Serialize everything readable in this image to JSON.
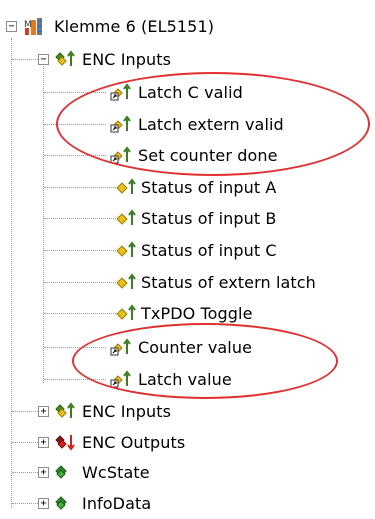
{
  "root": {
    "label": "Klemme 6 (EL5151)",
    "icon": "terminal-module-icon",
    "expander": "−"
  },
  "groups": [
    {
      "label": "ENC Inputs",
      "icon": "input-group-icon",
      "expander": "−",
      "children": [
        {
          "label": "Latch C valid",
          "icon": "linked-input-var-icon"
        },
        {
          "label": "Latch extern valid",
          "icon": "linked-input-var-icon"
        },
        {
          "label": "Set counter done",
          "icon": "linked-input-var-icon"
        },
        {
          "label": "Status of input A",
          "icon": "input-var-icon"
        },
        {
          "label": "Status of input B",
          "icon": "input-var-icon"
        },
        {
          "label": "Status of input C",
          "icon": "input-var-icon"
        },
        {
          "label": "Status of extern latch",
          "icon": "input-var-icon"
        },
        {
          "label": "TxPDO Toggle",
          "icon": "input-var-icon"
        },
        {
          "label": "Counter value",
          "icon": "linked-input-var-icon"
        },
        {
          "label": "Latch value",
          "icon": "linked-input-var-icon"
        }
      ]
    },
    {
      "label": "ENC Inputs",
      "icon": "input-group-icon",
      "expander": "+"
    },
    {
      "label": "ENC Outputs",
      "icon": "output-group-icon",
      "expander": "+"
    },
    {
      "label": "WcState",
      "icon": "wcstate-icon",
      "expander": "+"
    },
    {
      "label": "InfoData",
      "icon": "infodata-icon",
      "expander": "+"
    }
  ],
  "highlight_color": "#e03030"
}
